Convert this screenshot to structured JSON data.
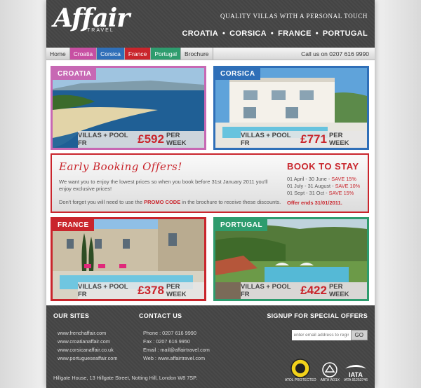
{
  "header": {
    "logo_text": "Affair",
    "logo_sub": "TRAVEL",
    "tagline": "QUALITY VILLAS WITH A PERSONAL TOUCH",
    "destinations": [
      "CROATIA",
      "CORSICA",
      "FRANCE",
      "PORTUGAL"
    ]
  },
  "nav": {
    "items": [
      "Home",
      "Croatia",
      "Corsica",
      "France",
      "Portugal",
      "Brochure"
    ],
    "phone": "Call us on 0207 616 9990"
  },
  "tiles": {
    "croatia": {
      "label": "CROATIA",
      "prefix": "VILLAS + POOL FR",
      "price": "£592",
      "suffix": "PER WEEK"
    },
    "corsica": {
      "label": "CORSICA",
      "prefix": "VILLAS + POOL FR",
      "price": "£771",
      "suffix": "PER WEEK"
    },
    "france": {
      "label": "FRANCE",
      "prefix": "VILLAS + POOL FR",
      "price": "£378",
      "suffix": "PER WEEK"
    },
    "portugal": {
      "label": "PORTUGAL",
      "prefix": "VILLAS + POOL FR",
      "price": "£422",
      "suffix": "PER WEEK"
    }
  },
  "offers": {
    "title": "Early Booking Offers!",
    "text1": "We want you to enjoy the lowest prices so when you book before 31st January 2011 you'll enjoy exclusive prices!",
    "text2_pre": "Don't forget you will need to use the",
    "promo": "PROMO CODE",
    "text2_post": "in the brochure to receive these discounts.",
    "book_title": "BOOK TO STAY",
    "lines": [
      {
        "dates": "01 April - 30 June -",
        "save": "SAVE 15%"
      },
      {
        "dates": "01 July - 31 August -",
        "save": "SAVE 10%"
      },
      {
        "dates": "01 Sept - 31 Oct -",
        "save": "SAVE 15%"
      }
    ],
    "offer_ends": "Offer ends 31/01/2011."
  },
  "footer": {
    "sites_heading": "OUR SITES",
    "sites": [
      "www.frenchaffair.com",
      "www.croatianaffair.com",
      "www.corsicanaffair.co.uk",
      "www.portugueseaffair.com"
    ],
    "contact_heading": "CONTACT US",
    "contact": [
      "Phone : 0207 616 9990",
      "Fax : 0207 616 9950",
      "Email : mail@affairtravel.com",
      "Web : www.affairtravel.com"
    ],
    "signup_heading": "SIGNUP FOR SPECIAL OFFERS",
    "email_placeholder": "enter email address to register",
    "go_label": "GO",
    "address": "Hillgate House, 13 Hillgate Street, Notting Hill, London W8 7SP.",
    "badges": [
      "ATOL PROTECTED",
      "ABTA W31X",
      "IATA 91253746"
    ]
  },
  "colors": {
    "croatia": "#c768b4",
    "corsica": "#2f6fb8",
    "france": "#c9252c",
    "portugal": "#2e9c6e"
  }
}
